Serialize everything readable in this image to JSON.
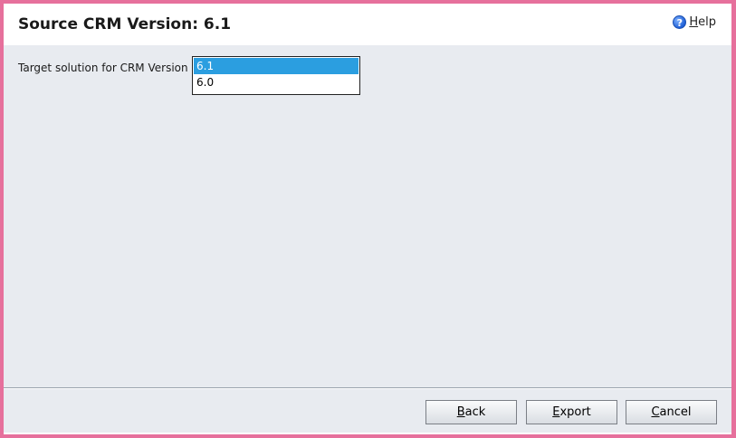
{
  "dialog": {
    "title": "Source CRM Version: 6.1",
    "help_label": "Help",
    "help_icon": "?"
  },
  "form": {
    "target_label": "Target solution for CRM Version",
    "options": [
      "6.1",
      "6.0"
    ],
    "selected": "6.1"
  },
  "buttons": {
    "back": "Back",
    "export": "Export",
    "cancel": "Cancel"
  },
  "colors": {
    "window_border": "#e6709c",
    "selection": "#2b9ee0",
    "body_bg": "#e8ebf0"
  }
}
